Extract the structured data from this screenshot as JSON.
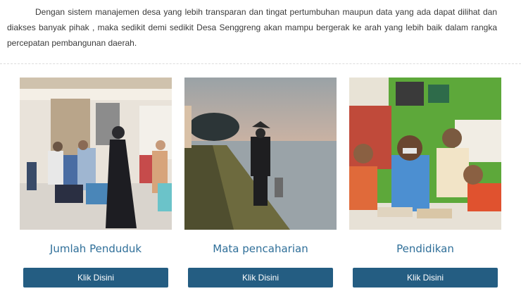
{
  "intro": {
    "paragraph": "Dengan sistem manajemen desa yang lebih transparan dan tingat pertumbuhan maupun data yang ada dapat dilihat dan diakses banyak pihak , maka sedikit demi sedikit Desa Senggreng akan mampu bergerak ke arah yang lebih baik dalam rangka percepatan pembangunan daerah."
  },
  "cards": [
    {
      "title": "Jumlah Penduduk",
      "button_label": "Klik Disini"
    },
    {
      "title": "Mata pencaharian",
      "button_label": "Klik Disini"
    },
    {
      "title": "Pendidikan",
      "button_label": "Klik Disini"
    }
  ],
  "colors": {
    "title_blue": "#2f6f99",
    "button_bg": "#245d82",
    "button_text": "#ffffff"
  }
}
